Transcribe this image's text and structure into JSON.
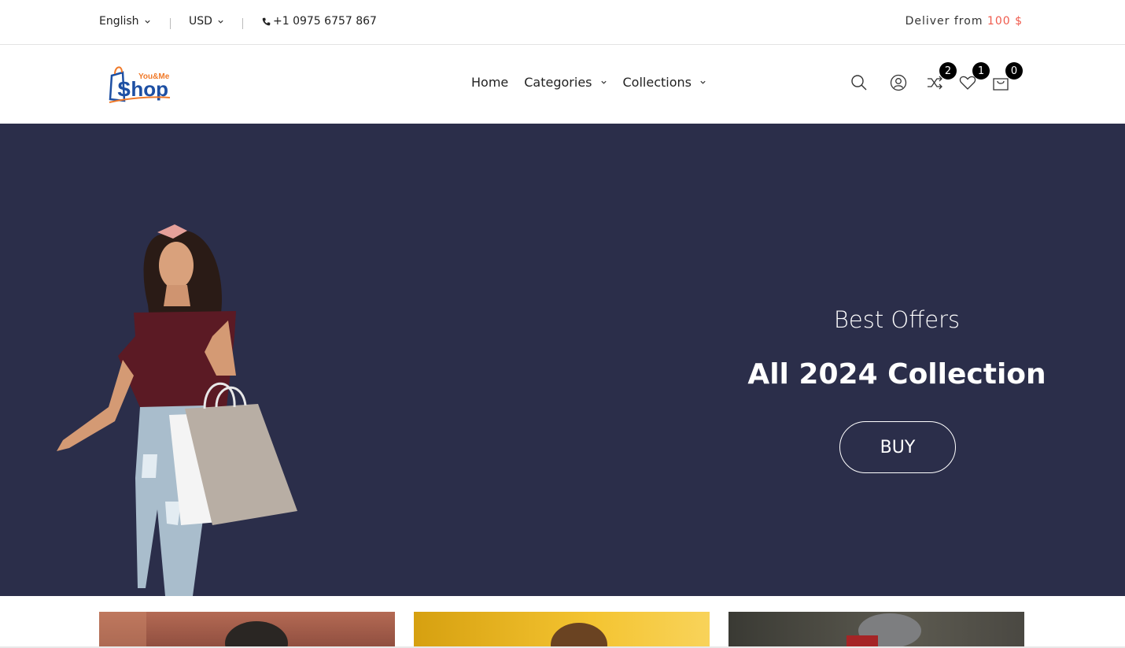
{
  "topbar": {
    "language": "English",
    "currency": "USD",
    "phone": "+1 0975 6757 867",
    "deliver_label": "Deliver from",
    "deliver_amount": "100 $"
  },
  "header": {
    "logo": {
      "text_top": "You&Me",
      "text_main": "Shop",
      "icon": "shopping-bag-logo"
    },
    "nav": [
      {
        "label": "Home",
        "dropdown": false
      },
      {
        "label": "Categories",
        "dropdown": true
      },
      {
        "label": "Collections",
        "dropdown": true
      }
    ],
    "icons": {
      "search": "search-icon",
      "account": "user-icon",
      "compare": {
        "icon": "shuffle-icon",
        "count": "2"
      },
      "wishlist": {
        "icon": "heart-icon",
        "count": "1"
      },
      "cart": {
        "icon": "cart-bag-icon",
        "count": "0"
      }
    }
  },
  "hero": {
    "subtitle": "Best Offers",
    "title": "All 2024 Collection",
    "button": "BUY",
    "background_color": "#2b2e4a"
  },
  "colors": {
    "accent": "#ef5a4c",
    "logo_blue": "#1d4fa3",
    "logo_orange": "#f07a2a",
    "badge": "#000000"
  }
}
